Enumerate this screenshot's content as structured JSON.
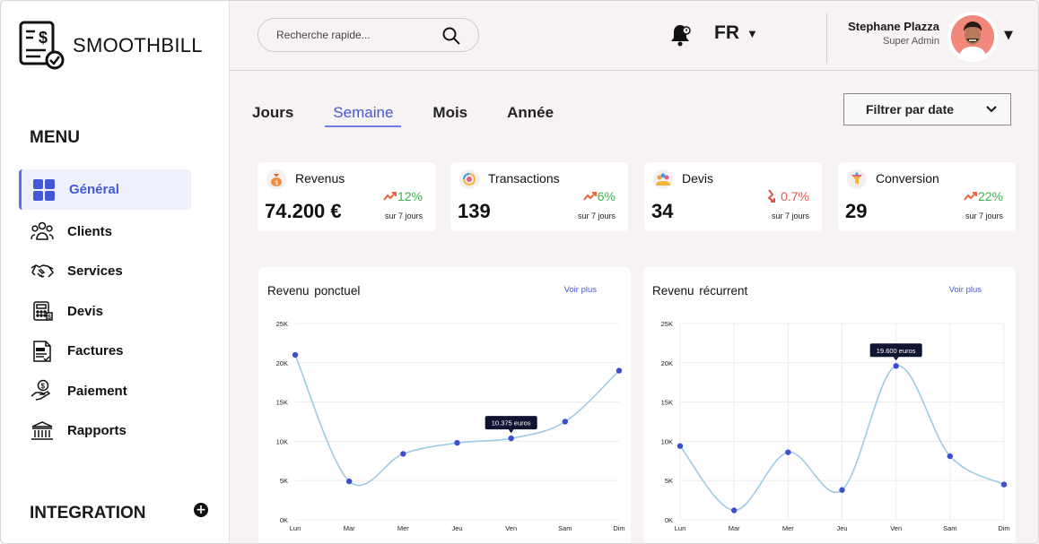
{
  "app": {
    "brand": "SMOOTHBILL"
  },
  "sidebar": {
    "menu_title": "MENU",
    "items": [
      {
        "label": "Général",
        "icon": "grid-icon",
        "active": true
      },
      {
        "label": "Clients",
        "icon": "users-icon"
      },
      {
        "label": "Services",
        "icon": "handshake-icon"
      },
      {
        "label": "Devis",
        "icon": "calculator-icon"
      },
      {
        "label": "Factures",
        "icon": "invoice-icon"
      },
      {
        "label": "Paiement",
        "icon": "hand-coin-icon"
      },
      {
        "label": "Rapports",
        "icon": "bank-icon"
      }
    ],
    "integration_title": "INTEGRATION"
  },
  "header": {
    "search_placeholder": "Recherche rapide...",
    "language": "FR",
    "user_name": "Stephane Plazza",
    "user_role": "Super Admin"
  },
  "tabs": [
    {
      "label": "Jours",
      "active": false
    },
    {
      "label": "Semaine",
      "active": true
    },
    {
      "label": "Mois",
      "active": false
    },
    {
      "label": "Année",
      "active": false
    }
  ],
  "filter": {
    "label": "Filtrer par date"
  },
  "stats": [
    {
      "title": "Revenus",
      "value": "74.200 €",
      "delta": "12%",
      "trend": "up",
      "period": "sur 7 jours",
      "icon": "money-bag-icon"
    },
    {
      "title": "Transactions",
      "value": "139",
      "delta": "6%",
      "trend": "up",
      "period": "sur 7 jours",
      "icon": "exchange-icon"
    },
    {
      "title": "Devis",
      "value": "34",
      "delta": "0.7%",
      "trend": "down",
      "period": "sur 7 jours",
      "icon": "quote-people-icon"
    },
    {
      "title": "Conversion",
      "value": "29",
      "delta": "22%",
      "trend": "up",
      "period": "sur 7 jours",
      "icon": "funnel-icon"
    }
  ],
  "colors": {
    "accent": "#4457d6",
    "line": "#9ccbe8",
    "point": "#3c4fd0",
    "up": "#3bb54a",
    "down": "#e2574c"
  },
  "panels": [
    {
      "title": "Revenu  ponctuel",
      "link": "Voir plus"
    },
    {
      "title": "Revenu  récurrent",
      "link": "Voir plus"
    }
  ],
  "chart_data": [
    {
      "type": "line",
      "title": "Revenu  ponctuel",
      "categories": [
        "Lun",
        "Mar",
        "Mer",
        "Jeu",
        "Ven",
        "Sam",
        "Dim"
      ],
      "yticks": [
        "0K",
        "5K",
        "10K",
        "15K",
        "20K",
        "25K"
      ],
      "ylim": [
        0,
        25000
      ],
      "values": [
        21000,
        4900,
        8400,
        9800,
        10375,
        12500,
        19000
      ],
      "tooltip": {
        "index": 4,
        "text": "10.375 euros"
      },
      "grid": "horizontal"
    },
    {
      "type": "line",
      "title": "Revenu  récurrent",
      "categories": [
        "Lun",
        "Mar",
        "Mer",
        "Jeu",
        "Ven",
        "Sam",
        "Dim"
      ],
      "yticks": [
        "0K",
        "5K",
        "10K",
        "15K",
        "20K",
        "25K"
      ],
      "ylim": [
        0,
        25000
      ],
      "values": [
        9400,
        1200,
        8600,
        3800,
        19600,
        8100,
        4500
      ],
      "tooltip": {
        "index": 4,
        "text": "19.600 euros"
      },
      "grid": "both"
    }
  ]
}
